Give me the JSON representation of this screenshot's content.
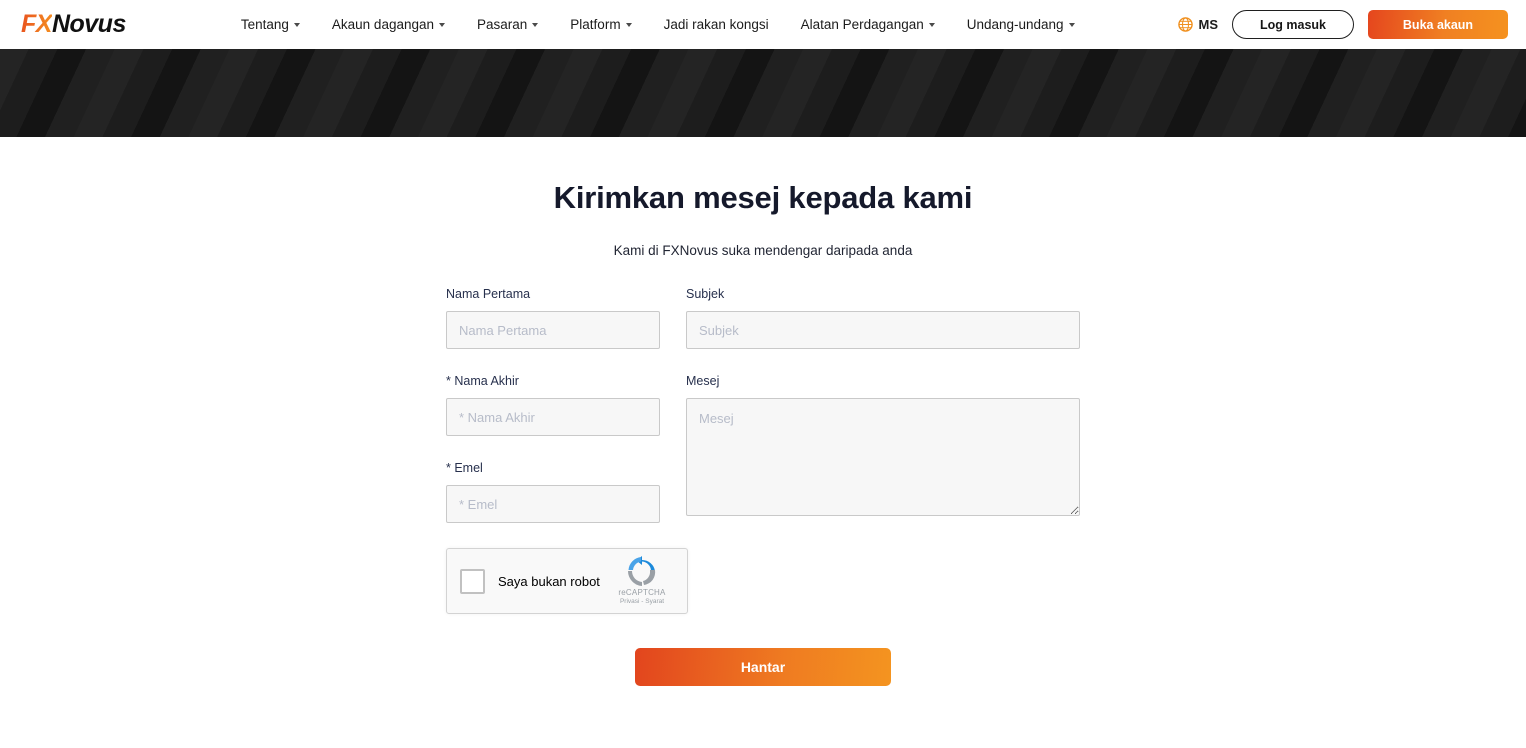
{
  "header": {
    "logo": {
      "part1": "FX",
      "part2": "Novus"
    },
    "nav": [
      {
        "label": "Tentang",
        "has_caret": true
      },
      {
        "label": "Akaun dagangan",
        "has_caret": true
      },
      {
        "label": "Pasaran",
        "has_caret": true
      },
      {
        "label": "Platform",
        "has_caret": true
      },
      {
        "label": "Jadi rakan kongsi",
        "has_caret": false
      },
      {
        "label": "Alatan Perdagangan",
        "has_caret": true
      },
      {
        "label": "Undang-undang",
        "has_caret": true
      }
    ],
    "language": {
      "code": "MS",
      "icon": "globe-icon"
    },
    "login_label": "Log masuk",
    "open_account_label": "Buka akaun"
  },
  "main": {
    "title": "Kirimkan mesej kepada kami",
    "subtitle": "Kami di FXNovus suka mendengar daripada anda"
  },
  "form": {
    "first_name": {
      "label": "Nama Pertama",
      "placeholder": "Nama Pertama",
      "value": ""
    },
    "last_name": {
      "label": "* Nama Akhir",
      "placeholder": "* Nama Akhir",
      "value": ""
    },
    "email": {
      "label": "* Emel",
      "placeholder": "* Emel",
      "value": ""
    },
    "subject": {
      "label": "Subjek",
      "placeholder": "Subjek",
      "value": ""
    },
    "message": {
      "label": "Mesej",
      "placeholder": "Mesej",
      "value": ""
    },
    "submit_label": "Hantar"
  },
  "recaptcha": {
    "checkbox_label": "Saya bukan robot",
    "brand": "reCAPTCHA",
    "privacy": "Privasi",
    "separator": "-",
    "terms": "Syarat"
  },
  "colors": {
    "accent_orange_start": "#e2451e",
    "accent_orange_end": "#f49420",
    "banner_dark": "#1d1d1d",
    "label_navy": "#27304d",
    "input_bg": "#f7f7f7",
    "input_border": "#c9c9c9",
    "placeholder": "#b7bcc9"
  }
}
